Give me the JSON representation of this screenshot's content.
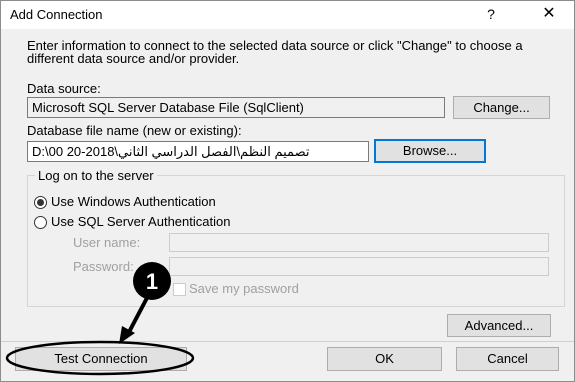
{
  "window": {
    "title": "Add Connection",
    "help_glyph": "?",
    "close_glyph": "✕"
  },
  "intro_text": "Enter information to connect to the selected data source or click \"Change\" to choose a different data source and/or provider.",
  "data_source": {
    "label": "Data source:",
    "value": "Microsoft SQL Server Database File (SqlClient)",
    "change_button": "Change..."
  },
  "database_file": {
    "label": "Database file name (new or existing):",
    "value": "D:\\00 تصميم النظم\\الفصل الدراسي الثاني\\2018-20",
    "browse_button": "Browse..."
  },
  "logon": {
    "legend": "Log on to the server",
    "windows_auth_label": "Use Windows Authentication",
    "sql_auth_label": "Use SQL Server Authentication",
    "selected": "Use Windows Authentication",
    "user_name_label": "User name:",
    "password_label": "Password:",
    "save_password_label": "Save my password"
  },
  "annotation": {
    "step_number": "1"
  },
  "buttons": {
    "advanced": "Advanced...",
    "test_connection": "Test Connection",
    "ok": "OK",
    "cancel": "Cancel"
  }
}
